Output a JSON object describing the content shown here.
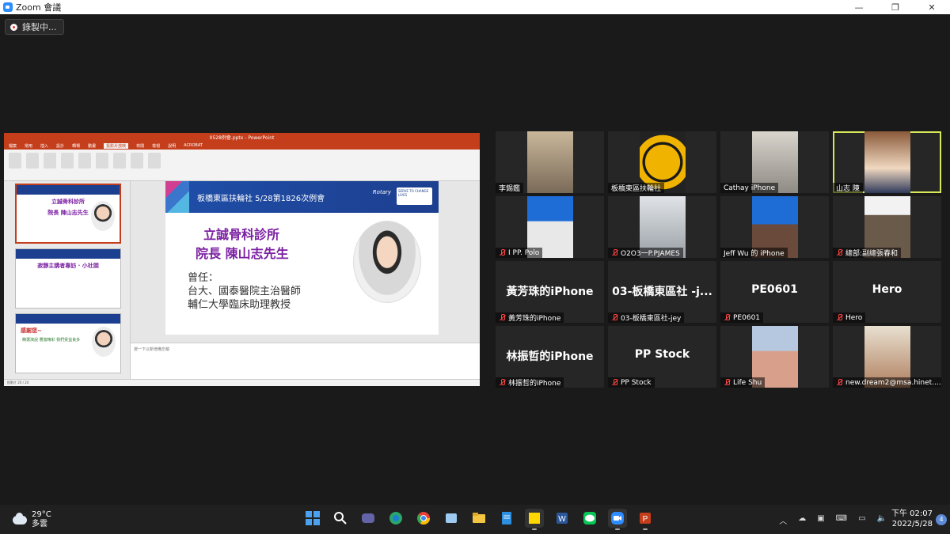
{
  "window": {
    "title": "Zoom 會議",
    "minimize": "—",
    "restore": "❐",
    "close": "✕"
  },
  "recording": {
    "label": "錄製中..."
  },
  "ppt": {
    "title": "0528例會.pptx - PowerPoint",
    "menu": [
      "檔案",
      "常用",
      "插入",
      "設計",
      "轉場",
      "動畫",
      "投影片放映",
      "校閱",
      "檢視",
      "說明",
      "ACROBAT"
    ],
    "active_menu": "投影片放映",
    "slide": {
      "band_text": "板橋東區扶輪社  5/28第1826次例會",
      "rotary": "Rotary",
      "serve": "SERVE TO CHANGE LIVES",
      "line1": "立誠骨科診所",
      "line2": "院長  陳山志先生",
      "body1": "曾任：",
      "body2": "台大、國泰醫院主治醫師",
      "body3": "輔仁大學臨床助理教授"
    },
    "thumbs": [
      {
        "num": "20",
        "title": "立誠骨科診所",
        "sub": "院長 陳山志先生"
      },
      {
        "num": "21",
        "title": "寂靜主講者專訪 · 小社頭",
        "sub": ""
      },
      {
        "num": "22",
        "title": "感謝您~",
        "sub": "精選演說 豐富精彩 我們受益良多"
      }
    ],
    "notes": "按一下以新增備忘稿",
    "status": "投影片 20 / 24"
  },
  "participants": [
    {
      "name": "李錫鑑",
      "muted": false,
      "video": true
    },
    {
      "name": "板橋東區扶輪社",
      "muted": false,
      "video": true
    },
    {
      "name": "Cathay iPhone",
      "muted": false,
      "video": true
    },
    {
      "name": "山志 陳",
      "muted": false,
      "video": true,
      "active": true
    },
    {
      "name": "I PP. Polo",
      "muted": true,
      "video": true
    },
    {
      "name": "O2O3一P.PJAMES",
      "muted": true,
      "video": true
    },
    {
      "name": "Jeff Wu 的 iPhone",
      "muted": false,
      "video": true
    },
    {
      "name": "總部:副總張春和",
      "muted": true,
      "video": true
    },
    {
      "name": "黃芳珠的iPhone",
      "display": "黃芳珠的iPhone",
      "muted": true,
      "video": false
    },
    {
      "name": "03-板橋東區社-jey",
      "display": "03-板橋東區社 -j...",
      "muted": true,
      "video": false
    },
    {
      "name": "PE0601",
      "display": "PE0601",
      "muted": true,
      "video": false
    },
    {
      "name": "Hero",
      "display": "Hero",
      "muted": true,
      "video": false
    },
    {
      "name": "林振哲的iPhone",
      "display": "林振哲的iPhone",
      "muted": true,
      "video": false
    },
    {
      "name": "PP Stock",
      "display": "PP Stock",
      "muted": true,
      "video": false
    },
    {
      "name": "Life Shu",
      "muted": true,
      "video": true
    },
    {
      "name": "new.dream2@msa.hinet....",
      "muted": true,
      "video": true
    }
  ],
  "taskbar": {
    "temp": "29°C",
    "weather": "多雲",
    "time": "下午 02:07",
    "date": "2022/5/28",
    "notifications": "4",
    "colors": {
      "zoom": "#2d8cff",
      "line": "#06c755",
      "word": "#2b579a",
      "ppt": "#c43e1c"
    }
  }
}
